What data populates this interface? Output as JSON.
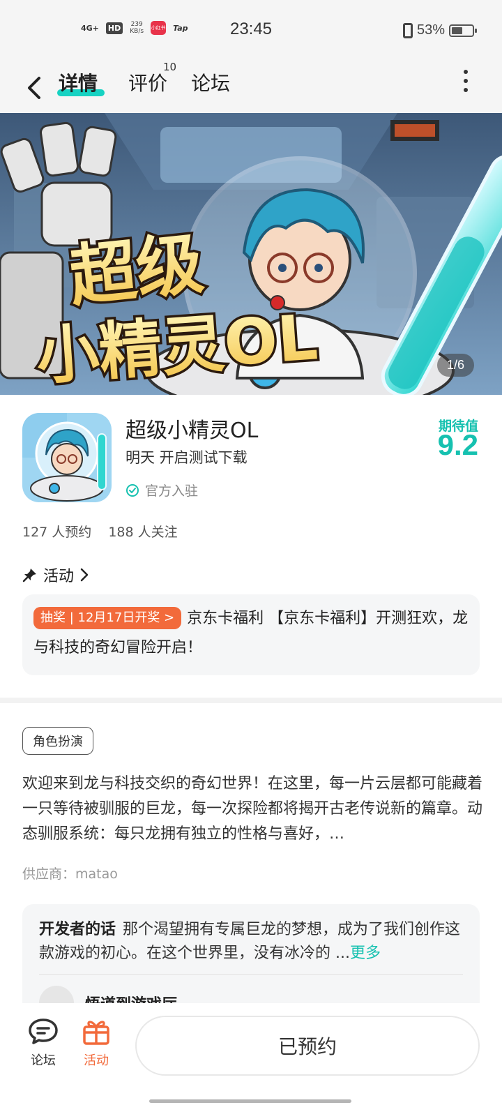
{
  "status_bar": {
    "signal": "4G+",
    "hd": "HD",
    "speed_value": "239",
    "speed_unit": "KB/s",
    "app_badge": "小红书",
    "tap_badge": "Tap",
    "time": "23:45",
    "battery": "53%",
    "battery_level": 0.53
  },
  "nav": {
    "tabs": [
      {
        "label": "详情",
        "active": true
      },
      {
        "label": "评价",
        "badge": "10"
      },
      {
        "label": "论坛"
      }
    ],
    "icons": [
      "back-icon",
      "more-icon"
    ]
  },
  "banner": {
    "page_indicator": "1/6",
    "art_text_line1": "超级",
    "art_text_line2": "小精灵OL"
  },
  "game": {
    "title": "超级小精灵OL",
    "status": "明天 开启测试下载",
    "verified": "官方入驻",
    "score_label": "期待值",
    "score": "9.2"
  },
  "stats": {
    "reservations": "127 人预约",
    "followers": "188 人关注"
  },
  "activity": {
    "header": "活动",
    "badge": "抽奖 | 12月17日开奖 >",
    "text": "京东卡福利 【京东卡福利】开测狂欢，龙与科技的奇幻冒险开启！"
  },
  "genre_tag": "角色扮演",
  "description": "欢迎来到龙与科技交织的奇幻世界！在这里，每一片云层都可能藏着一只等待被驯服的巨龙，每一次探险都将揭开古老传说新的篇章。动态驯服系统：每只龙拥有独立的性格与喜好，…",
  "supplier": "供应商：matao",
  "developer": {
    "title": "开发者的话",
    "text": "那个渴望拥有专属巨龙的梦想，成为了我们创作这款游戏的初心。在这个世界里，没有冰冷的 ...",
    "more": "更多",
    "author": "悟道到游戏厅"
  },
  "bottom_bar": {
    "forum_label": "论坛",
    "activity_label": "活动",
    "reserved_button": "已预约"
  },
  "colors": {
    "accent": "#16c1b0",
    "orange": "#f26a3b"
  }
}
